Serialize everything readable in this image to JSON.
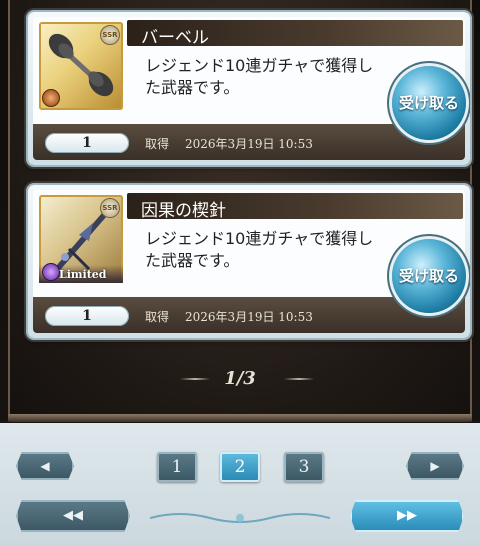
{
  "cards": [
    {
      "title": "バーベル",
      "description": "レジェンド10連ガチャで獲得した武器です。",
      "quantity": "1",
      "acquired_label": "取得",
      "acquired_date": "2026年3月19日 10:53",
      "button_label": "受け取る",
      "badge": "SSR",
      "limited": ""
    },
    {
      "title": "因果の楔針",
      "description": "レジェンド10連ガチャで獲得した武器です。",
      "quantity": "1",
      "acquired_label": "取得",
      "acquired_date": "2026年3月19日 10:53",
      "button_label": "受け取る",
      "badge": "SSR",
      "limited": "Limited"
    }
  ],
  "pager": {
    "indicator": "1/3",
    "pages": [
      "1",
      "2",
      "3"
    ],
    "current": "2",
    "prev_icon": "◀",
    "next_icon": "▶",
    "first_icon": "◀◀",
    "last_icon": "▶▶"
  },
  "colors": {
    "accent_blue": "#2687b2",
    "panel_brown": "#3a2f26"
  }
}
